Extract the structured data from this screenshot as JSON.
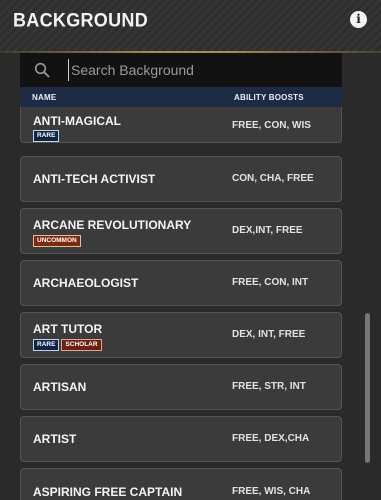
{
  "header": {
    "title": "BACKGROUND",
    "info_icon": "i"
  },
  "search": {
    "placeholder": "Search Background",
    "value": ""
  },
  "columns": {
    "name": "NAME",
    "boosts": "ABILITY BOOSTS"
  },
  "rows": [
    {
      "name": "ANTI-MAGICAL",
      "boosts": "FREE, CON, WIS",
      "tags": [
        "RARE"
      ]
    },
    {
      "name": "ANTI-TECH ACTIVIST",
      "boosts": "CON, CHA, FREE",
      "tags": []
    },
    {
      "name": "ARCANE REVOLUTIONARY",
      "boosts": "DEX,INT, FREE",
      "tags": [
        "UNCOMMON"
      ]
    },
    {
      "name": "ARCHAEOLOGIST",
      "boosts": "FREE, CON, INT",
      "tags": []
    },
    {
      "name": "ART TUTOR",
      "boosts": "DEX, INT, FREE",
      "tags": [
        "RARE",
        "SCHOLAR"
      ]
    },
    {
      "name": "ARTISAN",
      "boosts": "FREE, STR, INT",
      "tags": []
    },
    {
      "name": "ARTIST",
      "boosts": "FREE, DEX,CHA",
      "tags": []
    },
    {
      "name": "ASPIRING FREE CAPTAIN",
      "boosts": "FREE, WIS, CHA",
      "tags": []
    }
  ]
}
